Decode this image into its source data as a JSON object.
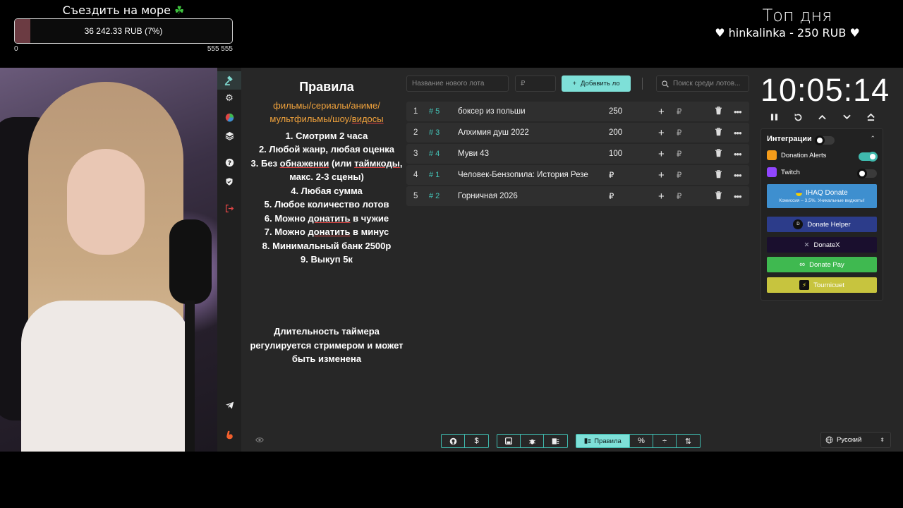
{
  "goal": {
    "title": "Съездить на море",
    "icon": "clover-icon",
    "amount_text": "36 242.33 RUB (7%)",
    "progress_percent": 7,
    "min_label": "0",
    "max_label": "555 555"
  },
  "top_day": {
    "title": "Топ дня",
    "entry": "hinkalinka - 250 RUB"
  },
  "sidebar": {
    "items": [
      {
        "icon": "gavel-icon",
        "active": true
      },
      {
        "icon": "gear-icon"
      },
      {
        "icon": "pie-chart-icon"
      },
      {
        "icon": "layers-icon"
      },
      {
        "icon": "help-icon"
      },
      {
        "icon": "shield-icon"
      },
      {
        "icon": "logout-icon"
      },
      {
        "icon": "telegram-icon"
      },
      {
        "icon": "boosty-icon"
      }
    ]
  },
  "rules": {
    "title": "Правила",
    "subtitle_line1": "фильмы/сериалы/аниме/",
    "subtitle_line2_a": "мультфильмы/шоу/",
    "subtitle_line2_b": "видосы",
    "r1": "1. Смотрим 2 часа",
    "r2": "2. Любой жанр, любая оценка",
    "r3_a": "3. Без ",
    "r3_b": "обнаженки",
    "r3_c": " (или ",
    "r3_d": "таймкоды",
    "r3_e": ", макс. 2-3 сцены)",
    "r4": "4. Любая сумма",
    "r5": "5. Любое количество лотов",
    "r6_a": "6. Можно ",
    "r6_b": "донатить",
    "r6_c": " в чужие",
    "r7_a": "7. Можно ",
    "r7_b": "донатить",
    "r7_c": " в минус",
    "r8": "8. Минимальный банк 2500р",
    "r9": "9. Выкуп 5к",
    "timer_note": "Длительность таймера регулируется стримером и может быть изменена"
  },
  "toolbar": {
    "lot_name_placeholder": "Название нового лота",
    "amount_placeholder": "₽",
    "add_label": "Добавить ло",
    "search_placeholder": "Поиск среди лотов..."
  },
  "lots": [
    {
      "num": "1",
      "rank": "# 5",
      "name": "боксер из польши",
      "amount": "250"
    },
    {
      "num": "2",
      "rank": "# 3",
      "name": "Алхимия душ 2022",
      "amount": "200"
    },
    {
      "num": "3",
      "rank": "# 4",
      "name": "Муви 43",
      "amount": "100"
    },
    {
      "num": "4",
      "rank": "# 1",
      "name": "Человек-Бензопила: История Резе",
      "amount": "₽"
    },
    {
      "num": "5",
      "rank": "# 2",
      "name": "Горничная 2026",
      "amount": "₽"
    }
  ],
  "lot_currency": "₽",
  "timer": {
    "value": "10:05:14"
  },
  "integrations": {
    "title": "Интеграции",
    "enabled": false,
    "services": [
      {
        "label": "Donation Alerts",
        "enabled": true,
        "color": "#f59c1a"
      },
      {
        "label": "Twitch",
        "enabled": false,
        "color": "#9146ff"
      }
    ],
    "ihaq": {
      "label": "IHAQ Donate",
      "note": "Комиссия – 3,5%. Уникальные виджеты!",
      "color": "#3e8fcf"
    },
    "donate_helper": {
      "label": "Donate Helper",
      "color": "#2c3c8a"
    },
    "donatex": {
      "label": "DonateX",
      "color": "#1a0f2e"
    },
    "donate_pay": {
      "label": "Donate Pay",
      "color": "#3fb950"
    },
    "tourniquet": {
      "label": "Tournicuet",
      "color": "#c7c43e"
    }
  },
  "bottom": {
    "rules_label": "Правила",
    "language": "Русский"
  }
}
